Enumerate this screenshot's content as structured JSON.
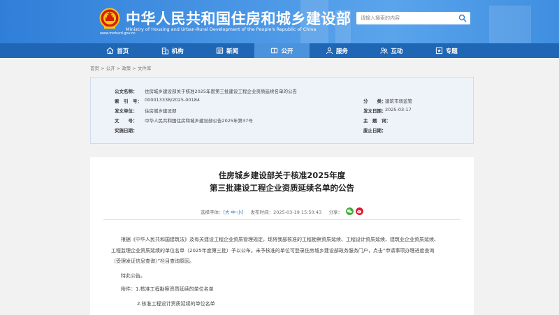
{
  "header": {
    "title_cn": "中华人民共和国住房和城乡建设部",
    "title_en": "Ministry of Housing and Urban-Rural Development of the People's Republic of China",
    "site_url": "www.mohurd.gov.cn",
    "search_placeholder": "请输入搜索的内容"
  },
  "nav": {
    "items": [
      {
        "label": "首页",
        "icon": "home-icon"
      },
      {
        "label": "机构",
        "icon": "building-icon"
      },
      {
        "label": "新闻",
        "icon": "news-icon"
      },
      {
        "label": "公开",
        "icon": "open-icon"
      },
      {
        "label": "服务",
        "icon": "service-icon"
      },
      {
        "label": "互动",
        "icon": "interact-icon"
      },
      {
        "label": "专题",
        "icon": "topic-icon"
      }
    ]
  },
  "breadcrumb": {
    "items": [
      "首页",
      "公开",
      "政策",
      "文件库"
    ],
    "separator": ">"
  },
  "info": {
    "subject_label": "公文名称：",
    "subject_value": "住房城乡建设部关于核准2025年度第三批建设工程企业资质延续名单的公告",
    "index_label": "索　引　号：",
    "index_value": "000013338/2025-00184",
    "category_label": "分　　类：",
    "category_value": "建筑市场监管",
    "issuer_label": "发文单位：",
    "issuer_value": "住房城乡建设部",
    "date_label": "发文日期：",
    "date_value": "2025-03-17",
    "docno_label": "文　　号：",
    "docno_value": "中华人民共和国住房和城乡建设部公告2025年第37号",
    "keywords_label": "主　题　词：",
    "keywords_value": "",
    "effective_label": "实施日期：",
    "effective_value": "",
    "expiry_label": "废止日期：",
    "expiry_value": ""
  },
  "article": {
    "title_line1": "住房城乡建设部关于核准2025年度",
    "title_line2": "第三批建设工程企业资质延续名单的公告",
    "font_label": "选择字体：",
    "font_open": "[",
    "font_large": "大",
    "font_mid": "中",
    "font_small": "小",
    "font_close": "]",
    "font_dot": "·",
    "publish_label": "发布时间：",
    "publish_time": "2025-03-19 15:50:43",
    "share_label": "分享：",
    "para1_line1": "根据《中华人民共和国建筑法》及有关建设工程企业资质管理规定，现将我部核准的工程勘察资质延续、工程设计资质延续、建筑业企业资质延续、",
    "para1_line2": "工程监理企业资质延续的单位名单（2025年度第三批）予以公布。未予核准的单位可登录住房城乡建设部政务服务门户，点击“申请事项办理进度查询",
    "para1_line3": "（受理发证信息查询）”栏目查询原因。",
    "para2": "特此公告。",
    "attach_label": "附件：",
    "attach1": "1.核准工程勘察资质延续的单位名单",
    "attach2": "2.核准工程设计资质延续的单位名单"
  },
  "colors": {
    "header_blue": "#3f8ee0",
    "nav_blue": "#1f66b5",
    "nav_active": "#4c93dd",
    "info_bg": "#eef3fa",
    "wechat_green": "#3cb034",
    "weibo_red": "#e6162d"
  }
}
